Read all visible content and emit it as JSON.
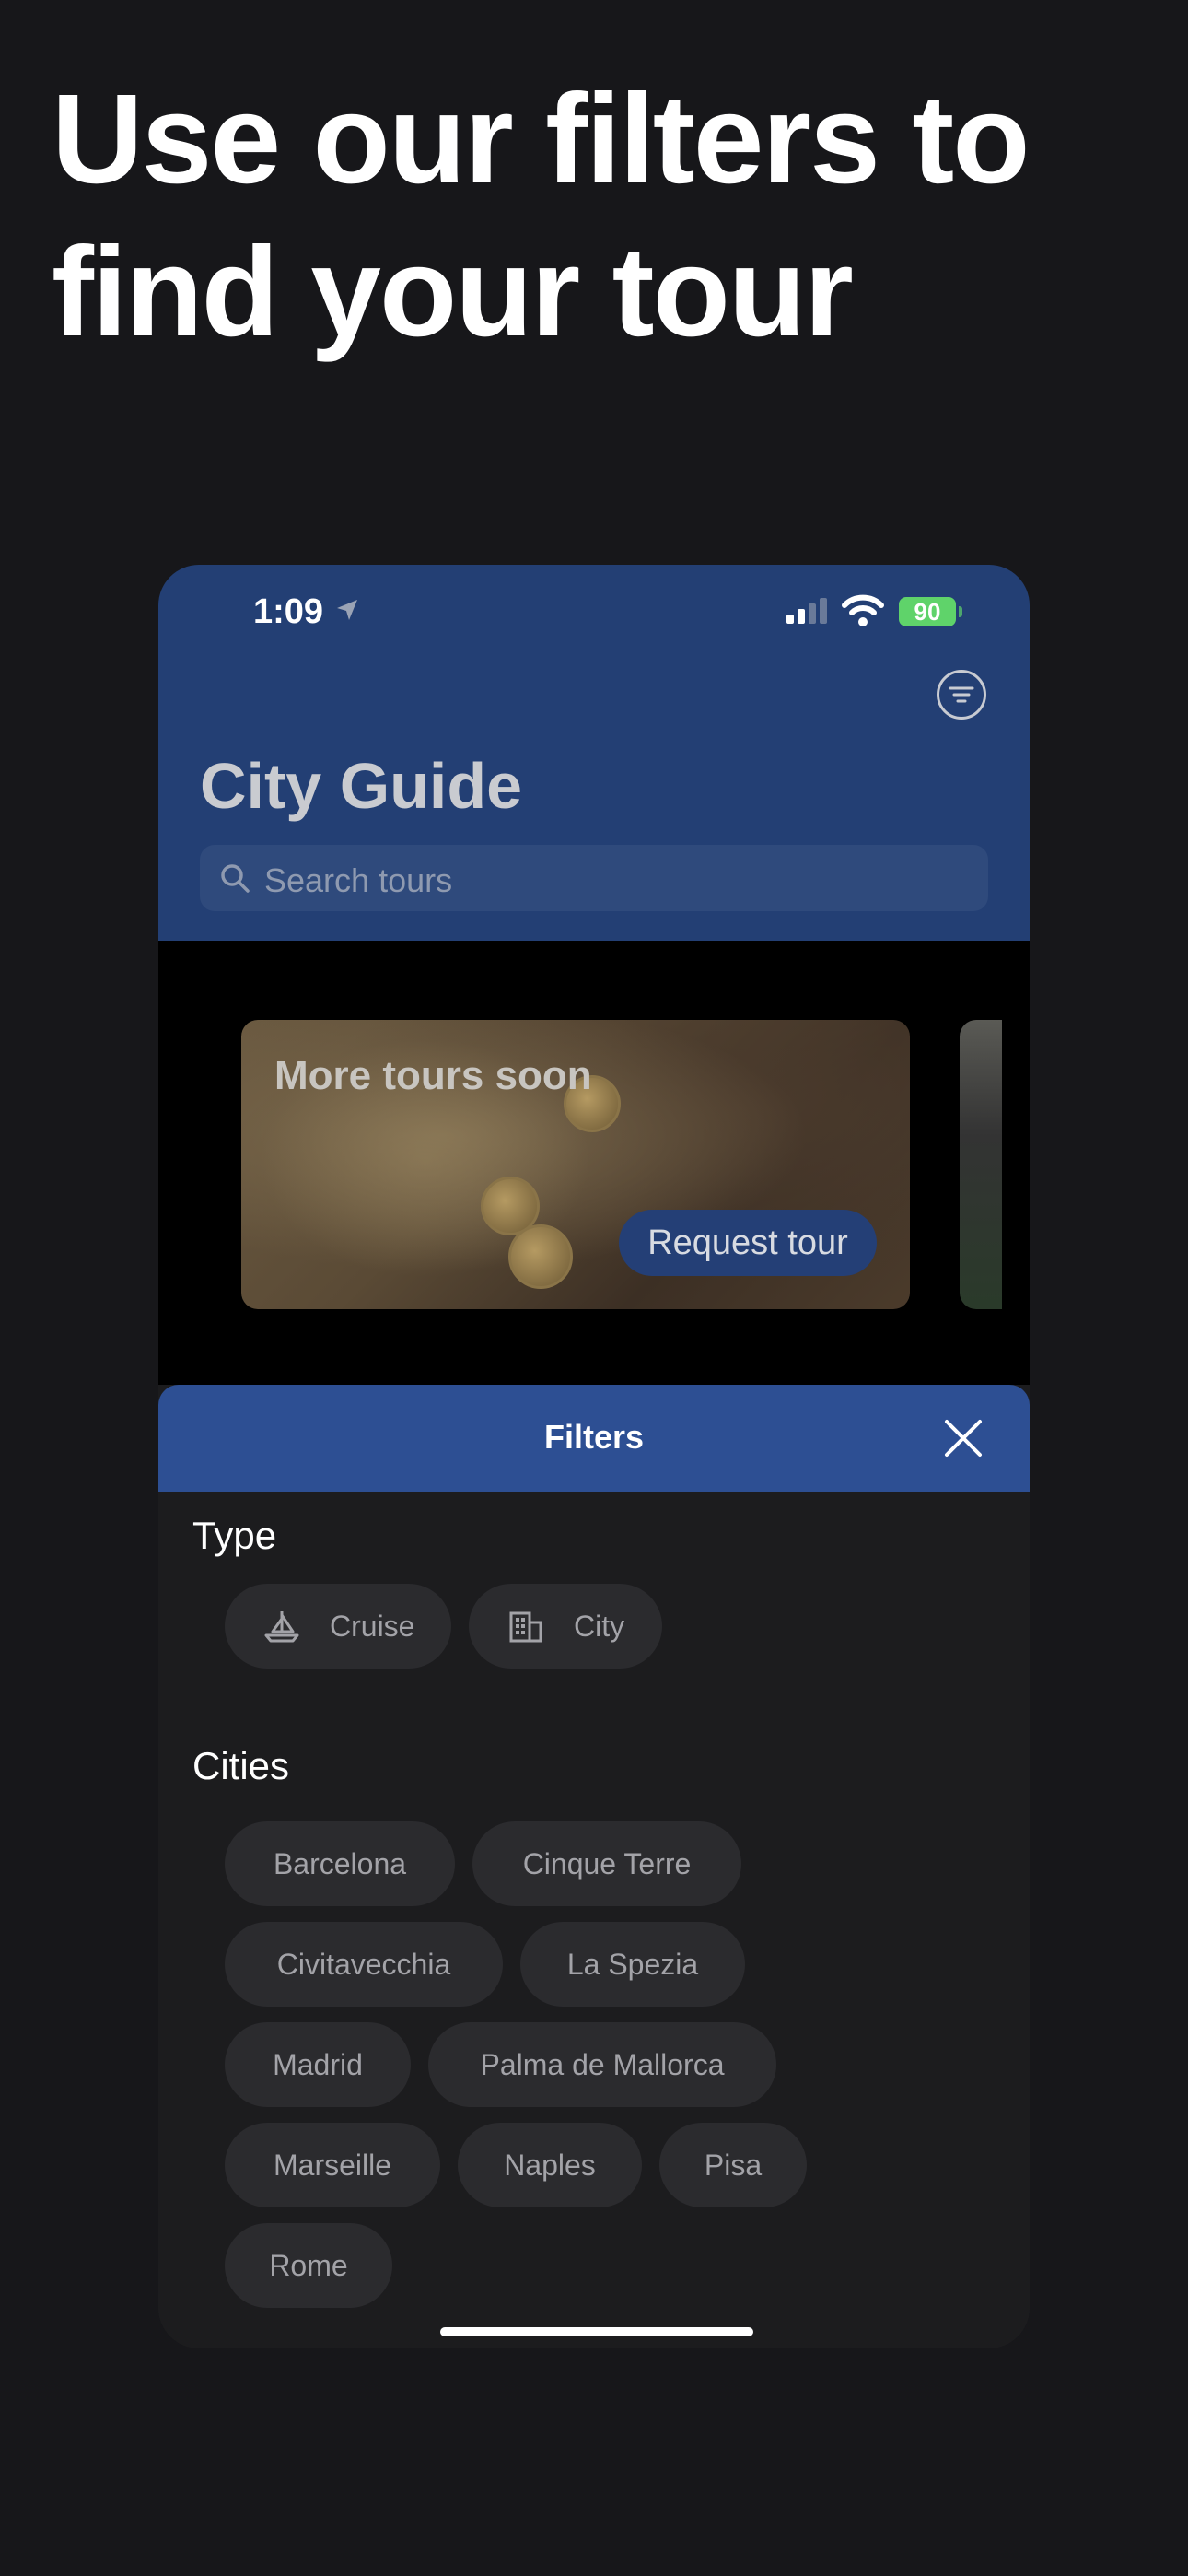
{
  "headline": {
    "line1": "Use our filters to",
    "line2": "find your tour"
  },
  "status_bar": {
    "time": "1:09",
    "battery": "90"
  },
  "nav": {
    "title": "City Guide",
    "search_placeholder": "Search tours"
  },
  "card": {
    "title": "More tours soon",
    "button": "Request tour"
  },
  "filters": {
    "title": "Filters",
    "type_label": "Type",
    "types": [
      {
        "label": "Cruise",
        "icon": "sailboat-icon"
      },
      {
        "label": "City",
        "icon": "building-icon"
      }
    ],
    "cities_label": "Cities",
    "cities": [
      "Barcelona",
      "Cinque Terre",
      "Civitavecchia",
      "La Spezia",
      "Madrid",
      "Palma de Mallorca",
      "Marseille",
      "Naples",
      "Pisa",
      "Rome"
    ]
  },
  "colors": {
    "background": "#17171a",
    "nav": "#233f74",
    "sheet_header": "#2d4f93",
    "chip": "#2b2b2e",
    "battery": "#5fd36a"
  }
}
